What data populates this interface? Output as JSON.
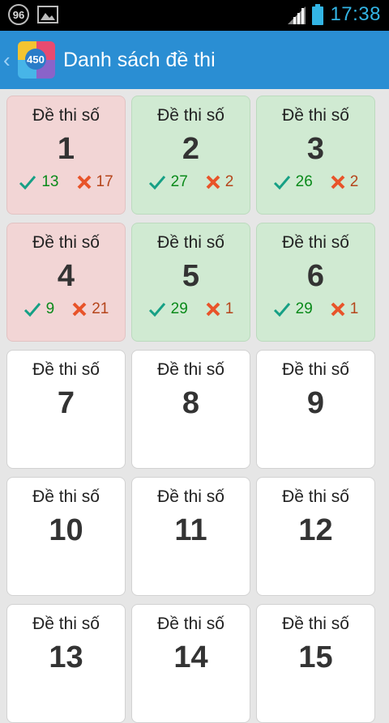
{
  "status_bar": {
    "notification_count": "96",
    "time": "17:38"
  },
  "action_bar": {
    "title": "Danh sách đề thi",
    "app_icon_text": "450"
  },
  "card_label": "Đề thi số",
  "cards": [
    {
      "number": "1",
      "correct": "13",
      "wrong": "17",
      "state": "fail"
    },
    {
      "number": "2",
      "correct": "27",
      "wrong": "2",
      "state": "pass"
    },
    {
      "number": "3",
      "correct": "26",
      "wrong": "2",
      "state": "pass"
    },
    {
      "number": "4",
      "correct": "9",
      "wrong": "21",
      "state": "fail"
    },
    {
      "number": "5",
      "correct": "29",
      "wrong": "1",
      "state": "pass"
    },
    {
      "number": "6",
      "correct": "29",
      "wrong": "1",
      "state": "pass"
    },
    {
      "number": "7",
      "state": "none"
    },
    {
      "number": "8",
      "state": "none"
    },
    {
      "number": "9",
      "state": "none"
    },
    {
      "number": "10",
      "state": "none"
    },
    {
      "number": "11",
      "state": "none"
    },
    {
      "number": "12",
      "state": "none"
    },
    {
      "number": "13",
      "state": "none"
    },
    {
      "number": "14",
      "state": "none"
    },
    {
      "number": "15",
      "state": "none"
    }
  ],
  "colors": {
    "action_bar": "#2a8ed3",
    "fail_card": "#f2d5d5",
    "pass_card": "#d0ead2",
    "correct": "#0a8a1a",
    "wrong_icon": "#e8542a"
  },
  "icons": {
    "correct": "check-icon",
    "wrong": "cross-icon"
  }
}
